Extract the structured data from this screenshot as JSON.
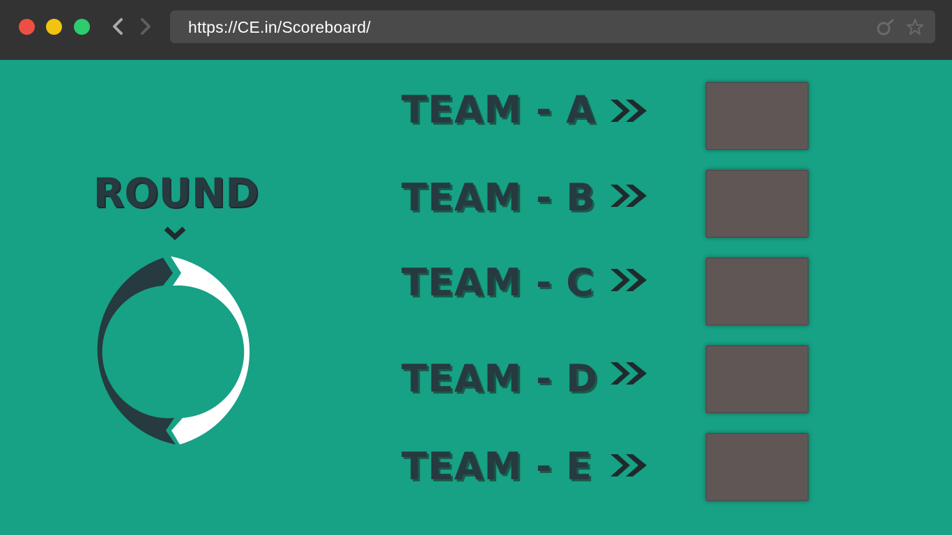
{
  "browser": {
    "url": "https://CE.in/Scoreboard/",
    "traffic_lights": {
      "close": "#ed4f43",
      "minimize": "#f2c40f",
      "maximize": "#2ecc71"
    },
    "icons": [
      "chevron-left-icon",
      "chevron-right-icon",
      "refresh-icon",
      "star-icon"
    ]
  },
  "round": {
    "title": "ROUND",
    "indicator_icon": "chevron-down-icon"
  },
  "teams": [
    {
      "label": "TEAM - A",
      "icon": "double-chevron-right-icon"
    },
    {
      "label": "TEAM - B",
      "icon": "double-chevron-right-icon"
    },
    {
      "label": "TEAM - C",
      "icon": "double-chevron-right-icon"
    },
    {
      "label": "TEAM - D",
      "icon": "double-chevron-right-icon"
    },
    {
      "label": "TEAM - E",
      "icon": "double-chevron-right-icon"
    }
  ],
  "colors": {
    "background": "#17a185",
    "dark": "#263a40",
    "score_box": "#615656",
    "ring_light": "#ffffff",
    "ring_dark": "#263a40"
  }
}
